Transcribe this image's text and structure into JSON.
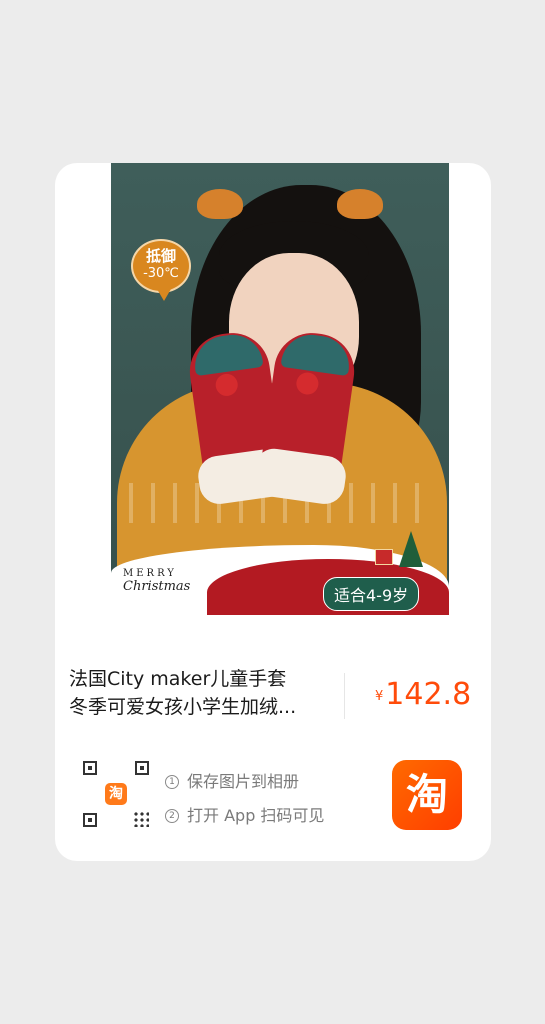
{
  "product": {
    "title_line1": "法国City maker儿童手套",
    "title_line2": "冬季可爱女孩小学生加绒...",
    "price_symbol": "¥",
    "price": "142.8"
  },
  "image": {
    "badge_line1": "抵御",
    "badge_line2": "-30℃",
    "merry": "MERRY",
    "christmas": "Christmas",
    "age_label": "适合4-9岁"
  },
  "share": {
    "step1_num": "1",
    "step1": "保存图片到相册",
    "step2_num": "2",
    "step2": "打开 App 扫码可见",
    "qr_center_glyph": "淘",
    "app_icon_glyph": "淘"
  },
  "colors": {
    "price": "#ff4b0a",
    "taobao_brand": "#ff5000",
    "card_bg": "#ffffff",
    "page_bg": "#ececec"
  }
}
